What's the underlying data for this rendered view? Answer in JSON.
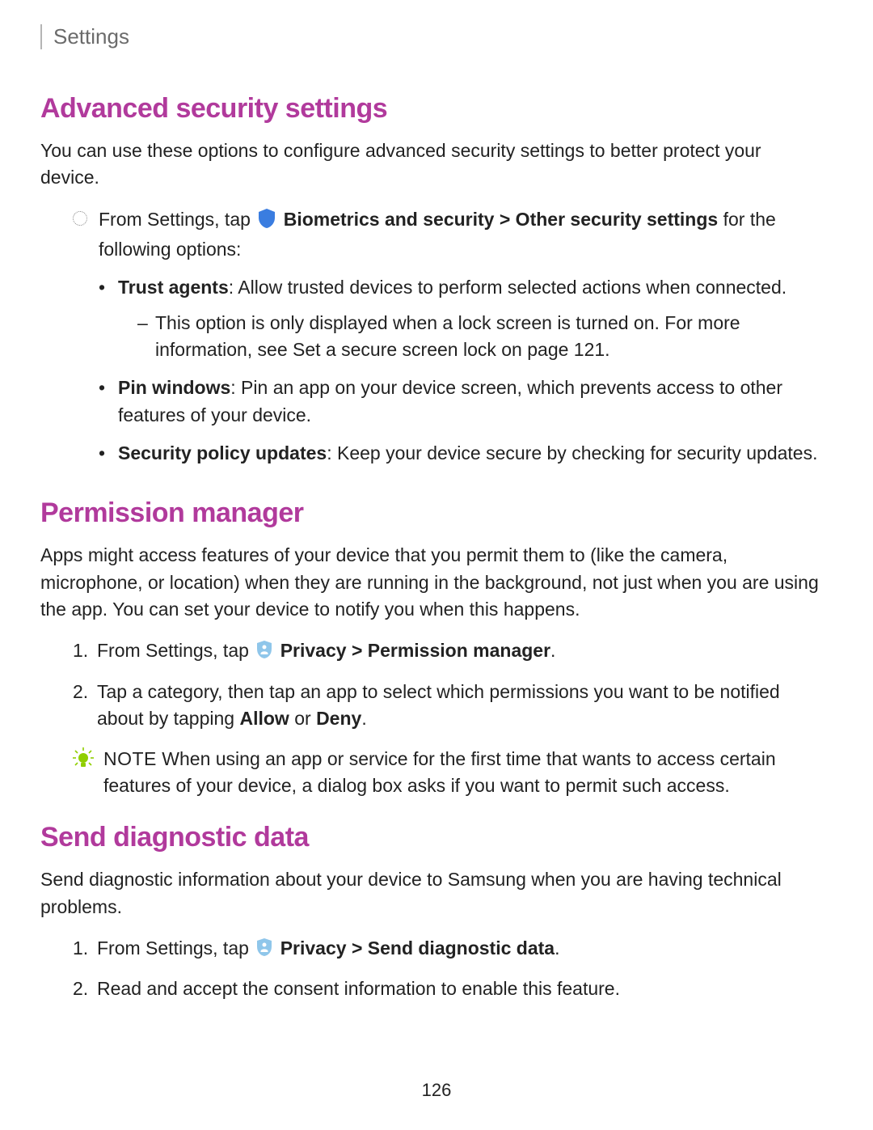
{
  "header": {
    "title": "Settings"
  },
  "section1": {
    "heading": "Advanced security settings",
    "intro": "You can use these options to configure advanced security settings to better protect your device.",
    "step_pre": "From Settings, tap ",
    "step_bold1": "Biometrics and security > Other security settings",
    "step_post": " for the following options:",
    "bullets": {
      "b1_bold": "Trust agents",
      "b1_text": ": Allow trusted devices to perform selected actions when connected.",
      "b1_dash_pre": "This option is only displayed when a lock screen is turned on. For more information, see ",
      "b1_dash_link": "Set a secure screen lock",
      "b1_dash_post": " on page 121.",
      "b2_bold": "Pin windows",
      "b2_text": ": Pin an app on your device screen, which prevents access to other features of your device.",
      "b3_bold": "Security policy updates",
      "b3_text": ": Keep your device secure by checking for security updates."
    }
  },
  "section2": {
    "heading": "Permission manager",
    "intro": "Apps might access features of your device that you permit them to (like the camera, microphone, or location) when they are running in the background, not just when you are using the app. You can set your device to notify you when this happens.",
    "n1_pre": "From Settings, tap ",
    "n1_bold": "Privacy > Permission manager",
    "n1_post": ".",
    "n2_pre": "Tap a category, then tap an app to select which permissions you want to be notified about by tapping ",
    "n2_allow": "Allow",
    "n2_or": " or ",
    "n2_deny": "Deny",
    "n2_post": ".",
    "note_label": "NOTE",
    "note_text": "  When using an app or service for the first time that wants to access certain features of your device, a dialog box asks if you want to permit such access."
  },
  "section3": {
    "heading": "Send diagnostic data",
    "intro": "Send diagnostic information about your device to Samsung when you are having technical problems.",
    "n1_pre": "From Settings, tap ",
    "n1_bold": "Privacy > Send diagnostic data",
    "n1_post": ".",
    "n2": "Read and accept the consent information to enable this feature."
  },
  "page_number": "126",
  "nums": {
    "one": "1.",
    "two": "2."
  }
}
